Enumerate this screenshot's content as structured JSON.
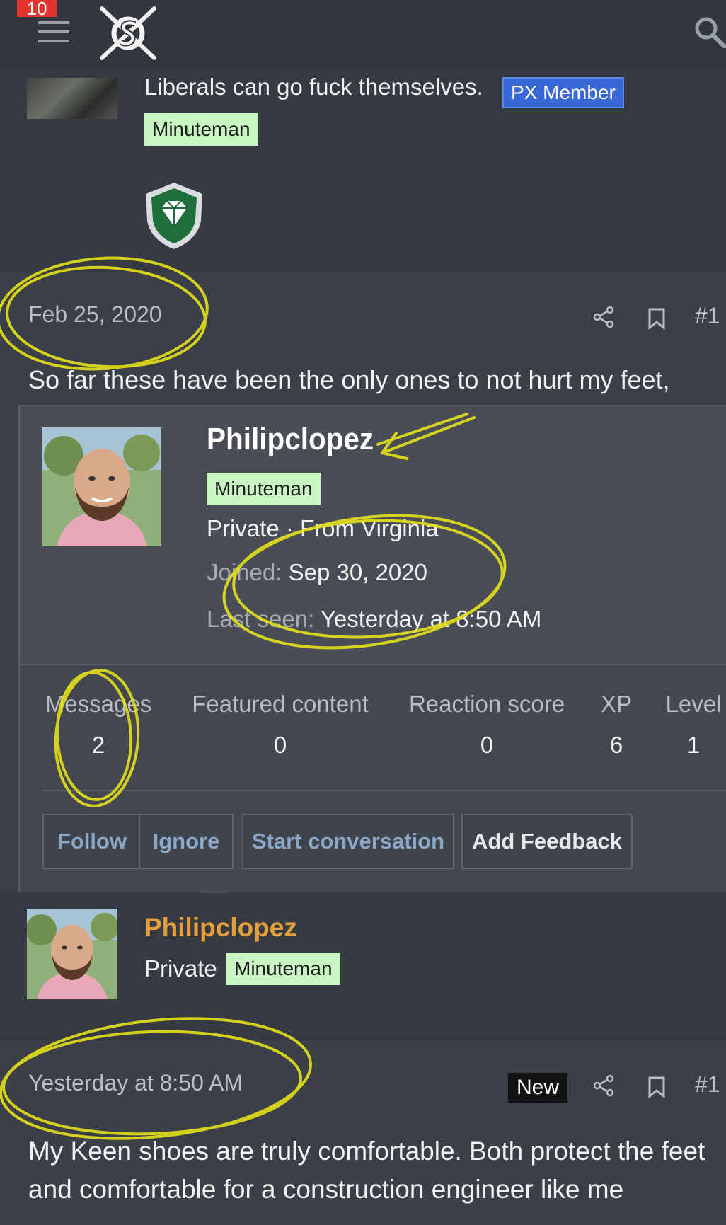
{
  "header": {
    "notification_count": "10",
    "menu_icon": "hamburger-icon",
    "logo_icon": "site-logo-icon",
    "search_icon": "search-icon"
  },
  "prev_post": {
    "signature": "Liberals can go fuck themselves.",
    "px_badge": "PX Member",
    "user_title_badge": "Minuteman",
    "trophy_icon": "diamond-shield-icon"
  },
  "post1": {
    "date": "Feb 25, 2020",
    "share_icon": "share-icon",
    "bookmark_icon": "bookmark-icon",
    "post_number": "#1",
    "body": "So far these have been the only ones to not hurt my feet,"
  },
  "member_card": {
    "username": "Philipclopez",
    "user_title": "Minuteman",
    "rank_line": "Private · From Virginia",
    "joined_label": "Joined:",
    "joined_value": "Sep 30, 2020",
    "last_seen_label": "Last seen:",
    "last_seen_value": "Yesterday at 8:50 AM",
    "stats": [
      {
        "label": "Messages",
        "value": "2"
      },
      {
        "label": "Featured content",
        "value": "0"
      },
      {
        "label": "Reaction score",
        "value": "0"
      },
      {
        "label": "XP",
        "value": "6"
      },
      {
        "label": "Level",
        "value": "1"
      }
    ],
    "buttons": {
      "follow": "Follow",
      "ignore": "Ignore",
      "start_conversation": "Start conversation",
      "add_feedback": "Add Feedback"
    }
  },
  "author": {
    "username": "Philipclopez",
    "rank": "Private",
    "user_title": "Minuteman"
  },
  "post2": {
    "date": "Yesterday at 8:50 AM",
    "new_badge": "New",
    "share_icon": "share-icon",
    "bookmark_icon": "bookmark-icon",
    "post_number": "#1",
    "body": "My Keen shoes are truly comfortable. Both protect the feet and comfortable for a construction engineer like me"
  },
  "colors": {
    "background": "#363a42",
    "post_background": "#3b3f47",
    "card_background": "#4a4f58",
    "username_orange": "#e5a03b",
    "badge_green": "#c8f5c2",
    "badge_blue": "#3867d6",
    "annotation_yellow": "#e6e21a"
  }
}
